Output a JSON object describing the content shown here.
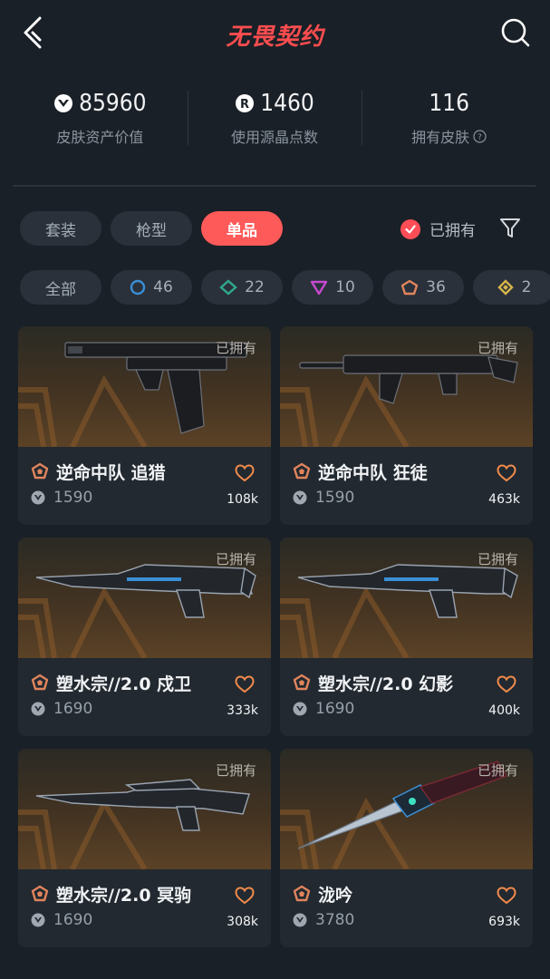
{
  "header": {
    "title": "无畏契约"
  },
  "stats": [
    {
      "value": "85960",
      "label": "皮肤资产价值",
      "icon": "valorant-points-icon"
    },
    {
      "value": "1460",
      "label": "使用源晶点数",
      "icon": "radianite-points-icon"
    },
    {
      "value": "116",
      "label": "拥有皮肤",
      "icon": "help-circle-icon"
    }
  ],
  "tabs": [
    {
      "label": "套装",
      "active": false
    },
    {
      "label": "枪型",
      "active": false
    },
    {
      "label": "单品",
      "active": true
    }
  ],
  "owned_filter": {
    "label": "已拥有",
    "checked": true
  },
  "rarity_chips": [
    {
      "label": "全部"
    },
    {
      "label": "46",
      "color": "#3a8fd6",
      "icon": "select-tier-icon"
    },
    {
      "label": "22",
      "color": "#2fa88a",
      "icon": "deluxe-tier-icon"
    },
    {
      "label": "10",
      "color": "#c64ad0",
      "icon": "premium-tier-icon"
    },
    {
      "label": "36",
      "color": "#e0845c",
      "icon": "exclusive-tier-icon"
    },
    {
      "label": "2",
      "color": "#d6b44a",
      "icon": "ultra-tier-icon"
    }
  ],
  "skins": [
    {
      "name": "逆命中队 追猎",
      "price": "1590",
      "likes": "108k",
      "owned": "已拥有",
      "weapon": "pistol"
    },
    {
      "name": "逆命中队 狂徒",
      "price": "1590",
      "likes": "463k",
      "owned": "已拥有",
      "weapon": "rifle"
    },
    {
      "name": "塑水宗//2.0 戍卫",
      "price": "1690",
      "likes": "333k",
      "owned": "已拥有",
      "weapon": "rifle2"
    },
    {
      "name": "塑水宗//2.0 幻影",
      "price": "1690",
      "likes": "400k",
      "owned": "已拥有",
      "weapon": "rifle2"
    },
    {
      "name": "塑水宗//2.0 冥驹",
      "price": "1690",
      "likes": "308k",
      "owned": "已拥有",
      "weapon": "sniper"
    },
    {
      "name": "泷吟",
      "price": "3780",
      "likes": "693k",
      "owned": "已拥有",
      "weapon": "knife"
    }
  ],
  "colors": {
    "accent": "#ff5a5a",
    "tier_exclusive": "#e0845c"
  }
}
